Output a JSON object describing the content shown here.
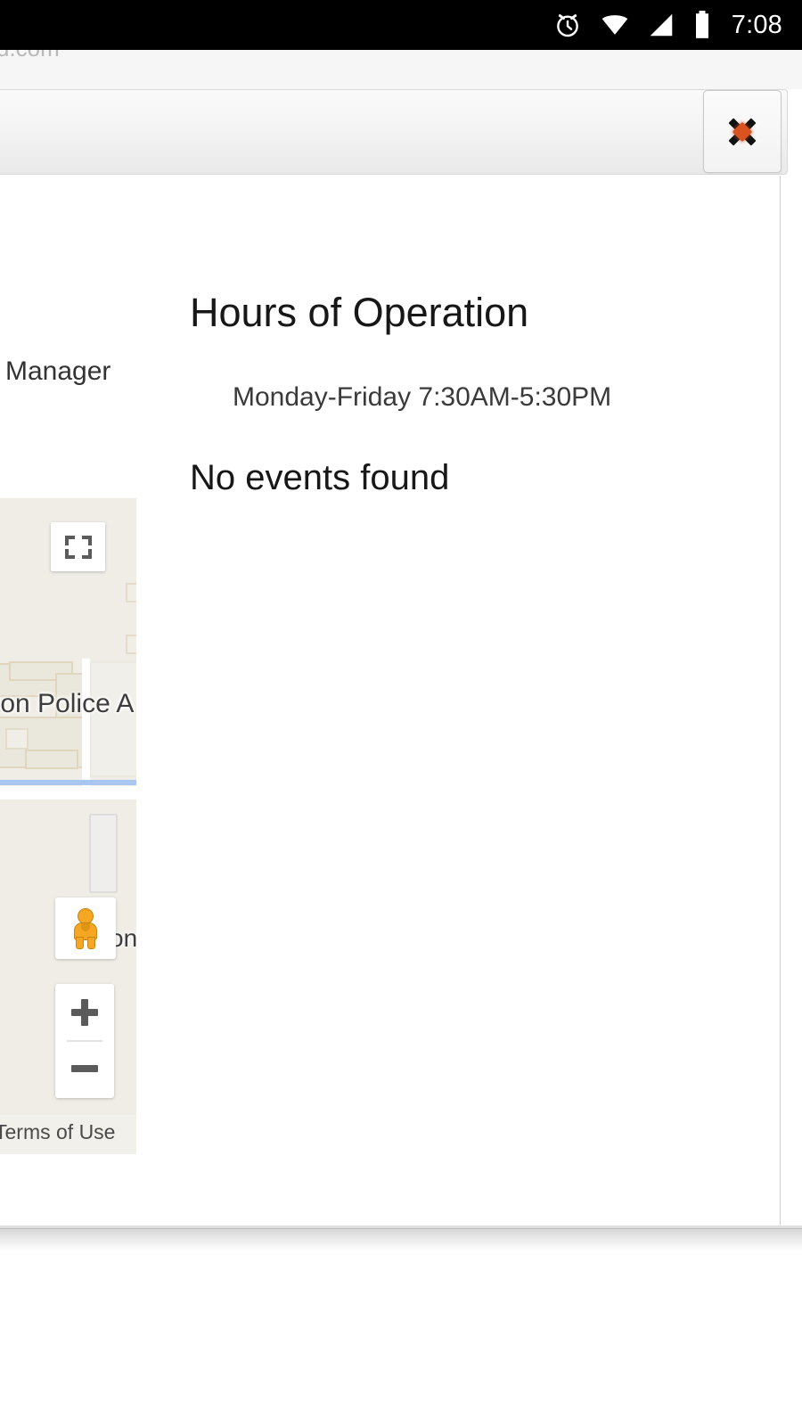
{
  "status_bar": {
    "time": "7:08",
    "icons": [
      "alarm-icon",
      "wifi-icon",
      "cellular-signal-icon",
      "battery-icon"
    ]
  },
  "browser": {
    "url_text": "d.com"
  },
  "toolbar": {
    "close_label": "✕",
    "close_icon": "close-x-icon"
  },
  "page": {
    "manager_label": "Manager",
    "hours_title": "Hours of Operation",
    "hours_value": "Monday-Friday 7:30AM-5:30PM",
    "events_status": "No events found"
  },
  "map": {
    "place_label": "ton Police A",
    "street_label": "on",
    "terms_label": "Terms of Use",
    "controls": {
      "fullscreen_icon": "fullscreen-icon",
      "pegman_icon": "street-view-pegman-icon",
      "zoom_in_label": "+",
      "zoom_out_label": "−"
    },
    "colors": {
      "background": "#efede6",
      "building_fill": "#eae7dc",
      "building_stroke": "#e0d6be",
      "road": "#ffffff",
      "water": "#a9c6f0"
    }
  },
  "colors": {
    "status_bar_bg": "#000000",
    "chrome_bg": "#f6f6f6",
    "toolbar_top": "#fafafa",
    "toolbar_bottom": "#e9e9e9",
    "close_accent": "#d9521f",
    "card_bg": "#ffffff",
    "text_primary": "#171717"
  }
}
